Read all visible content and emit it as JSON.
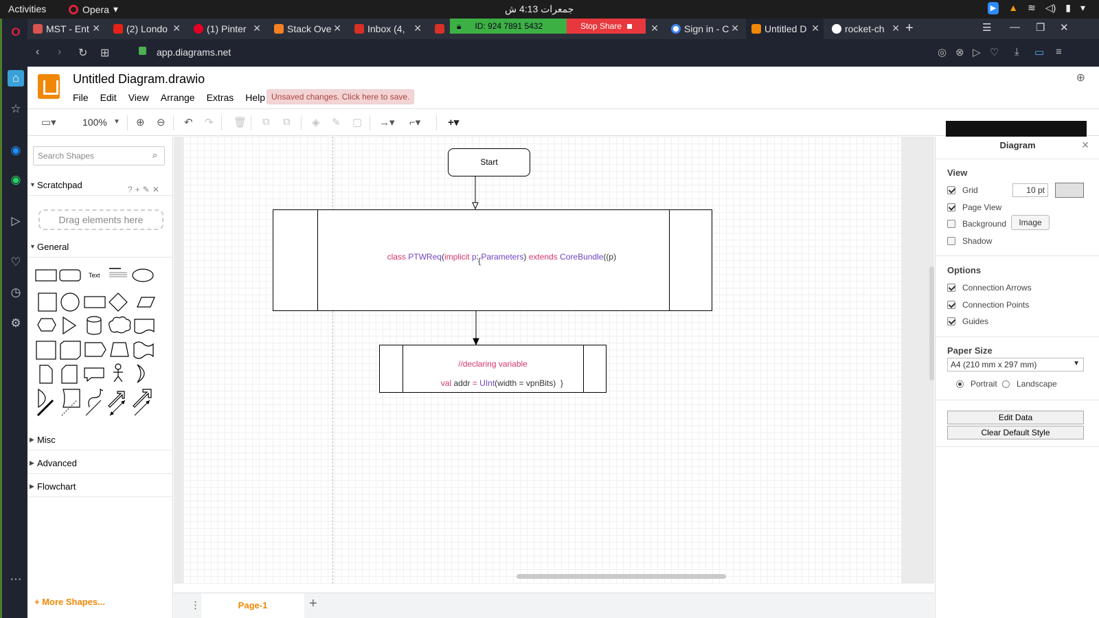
{
  "system": {
    "activities": "Activities",
    "browser_menu": "Opera",
    "clock": "جمعرات  4:13 ش"
  },
  "tabs": [
    {
      "label": "MST - Ent",
      "color": "#d9534f"
    },
    {
      "label": "(2) Londo",
      "color": "#e62117"
    },
    {
      "label": "(1) Pinter",
      "color": "#e60023"
    },
    {
      "label": "Stack Ove",
      "color": "#f48024"
    },
    {
      "label": "Inbox (4,",
      "color": "#d93025"
    },
    {
      "label": "",
      "color": "#d93025"
    },
    {
      "label": "Sign in - C",
      "color": "#4285f4"
    },
    {
      "label": "Untitled D",
      "color": "#f08705"
    },
    {
      "label": "rocket-ch",
      "color": "#ffffff"
    }
  ],
  "zoom_bar": {
    "meeting_id": "ID: 924 7891 5432",
    "stop_label": "Stop Share"
  },
  "address": {
    "url": "app.diagrams.net"
  },
  "app": {
    "doc_title": "Untitled Diagram.drawio",
    "menu": [
      "File",
      "Edit",
      "View",
      "Arrange",
      "Extras",
      "Help"
    ],
    "unsaved_notice": "Unsaved changes. Click here to save.",
    "zoom_level": "100%"
  },
  "shape_panel": {
    "search_placeholder": "Search Shapes",
    "scratchpad_title": "Scratchpad",
    "dropzone_text": "Drag elements here",
    "general_title": "General",
    "misc_title": "Misc",
    "advanced_title": "Advanced",
    "flowchart_title": "Flowchart",
    "more_shapes": "+ More Shapes...",
    "text_shape_label": "Text"
  },
  "diagram": {
    "start_label": "Start",
    "class_line1": {
      "kw_class": "class ",
      "name": "PTWReq",
      "paren_open": "(",
      "kw_implicit": "implicit ",
      "p": "p",
      "colon": ": ",
      "type": "Parameters",
      "paren_close": ") ",
      "kw_extends": "extends ",
      "parent": "CoreBundle",
      "args": "((p)"
    },
    "class_line2": "{",
    "decl_comment": "//declaring variable",
    "decl_line": {
      "kw_val": "val ",
      "name": "addr ",
      "eq": "= ",
      "type": "UInt",
      "args": "(width = vpnBits)  }"
    }
  },
  "page_tab": "Page-1",
  "format_panel": {
    "title": "Diagram",
    "view_header": "View",
    "grid_label": "Grid",
    "grid_checked": true,
    "grid_size": "10 pt",
    "page_view_label": "Page View",
    "page_view_checked": true,
    "background_label": "Background",
    "background_checked": false,
    "image_button": "Image",
    "shadow_label": "Shadow",
    "shadow_checked": false,
    "options_header": "Options",
    "connection_arrows_label": "Connection Arrows",
    "connection_points_label": "Connection Points",
    "guides_label": "Guides",
    "paper_size_header": "Paper Size",
    "paper_size_value": "A4 (210 mm x 297 mm)",
    "portrait_label": "Portrait",
    "landscape_label": "Landscape",
    "orientation": "portrait",
    "edit_data_button": "Edit Data",
    "clear_style_button": "Clear Default Style"
  },
  "colors": {
    "accent": "#f08705",
    "keyword_red": "#d6336c",
    "type_purple": "#6f42c1",
    "zoom_green": "#3cb043",
    "zoom_red": "#e8383d"
  }
}
